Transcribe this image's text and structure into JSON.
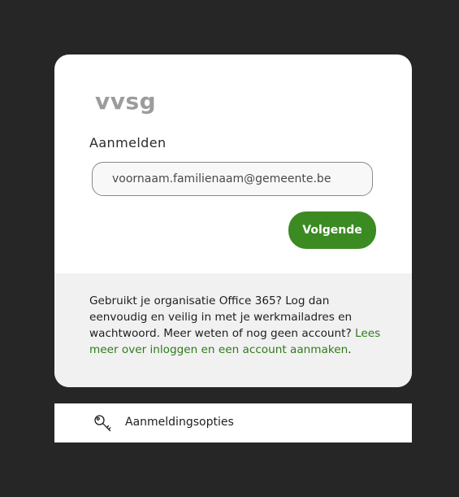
{
  "brand": {
    "logo_text": "vvsg"
  },
  "signin": {
    "title": "Aanmelden",
    "email_value": "voornaam.familienaam@gemeente.be",
    "next_label": "Volgende"
  },
  "info": {
    "text": "Gebruikt je organisatie Office 365? Log dan eenvoudig en veilig in met je werkmailadres en wachtwoord. Meer weten of nog geen account? ",
    "link_text": "Lees meer over inloggen en een account aanmaken",
    "suffix": "."
  },
  "options": {
    "label": "Aanmeldingsopties",
    "icon": "key-icon"
  },
  "colors": {
    "accent": "#3b8a22",
    "link": "#2f7a1b",
    "background": "#262626",
    "footer_bg": "#f1f1f1"
  }
}
